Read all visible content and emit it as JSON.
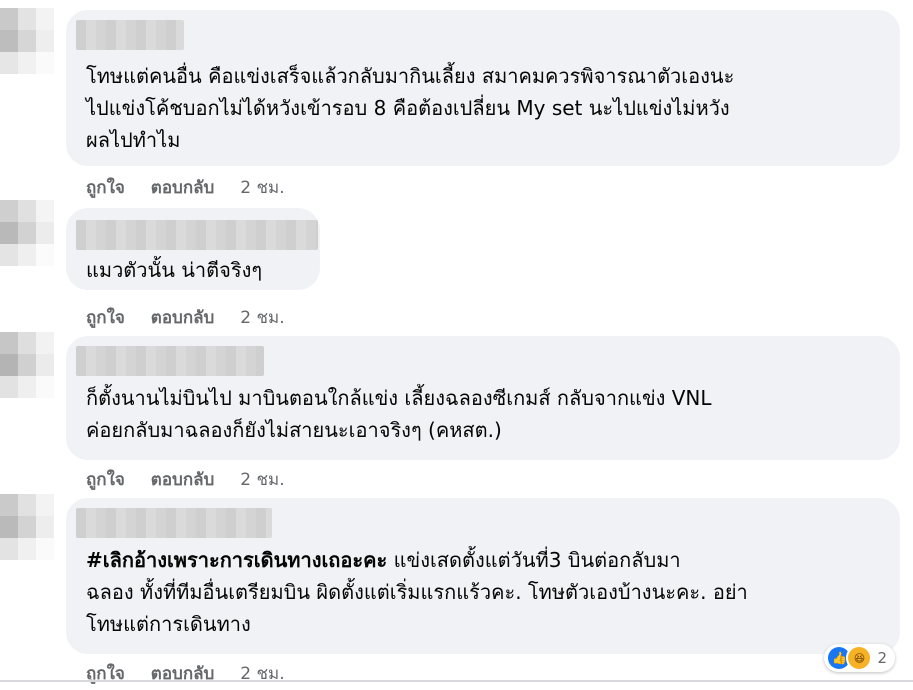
{
  "comments": [
    {
      "lines": [
        "โทษแต่คนอื่น คือแข่งเสร็จแล้วกลับมากินเลี้ยง สมาคมควรพิจารณาตัวเองนะ",
        "ไปแข่งโค้ชบอกไม่ได้หวังเข้ารอบ 8 คือต้องเปลี่ยน My set นะไปแข่งไม่หวัง",
        "ผลไปทำไม"
      ],
      "like": "ถูกใจ",
      "reply": "ตอบกลับ",
      "time": "2 ชม."
    },
    {
      "lines": [
        "แมวตัวนั้น น่าตีจริงๆ"
      ],
      "like": "ถูกใจ",
      "reply": "ตอบกลับ",
      "time": "2 ชม."
    },
    {
      "lines": [
        "ก็ตั้งนานไม่บินไป มาบินตอนใกล้แข่ง เลี้ยงฉลองซีเกมส์ กลับจากแข่ง VNL",
        "ค่อยกลับมาฉลองก็ยังไม่สายนะเอาจริงๆ (คหสต.)"
      ],
      "like": "ถูกใจ",
      "reply": "ตอบกลับ",
      "time": "2 ชม."
    },
    {
      "hashtag": "#เลิกอ้างเพราะการเดินทางเถอะคะ",
      "line1_rest": " แข่งเสดตั้งแต่วันที่3 บินต่อกลับมา",
      "lines": [
        "ฉลอง ทั้งที่ทีมอื่นเตรียมบิน ผิดตั้งแต่เริ่มแรกแร้วคะ. โทษตัวเองบ้างนะคะ. อย่า",
        "โทษแต่การเดินทาง"
      ],
      "like": "ถูกใจ",
      "reply": "ตอบกลับ",
      "time": "2 ชม.",
      "reaction_count": "2"
    }
  ],
  "icons": {
    "like": "like-icon",
    "haha": "haha-icon"
  },
  "colors": {
    "bubble": "#f0f2f5",
    "meta": "#65676b",
    "like_blue": "#1877f2"
  }
}
